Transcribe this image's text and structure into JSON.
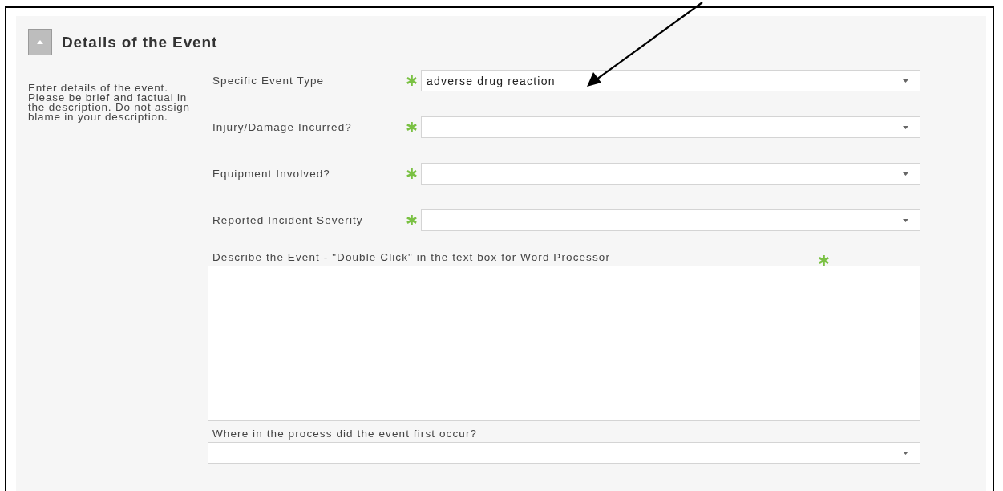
{
  "section": {
    "title": "Details of the Event",
    "expanded": true
  },
  "instructions": "Enter details of the event. Please be brief and factual in the description. Do not assign blame in your description.",
  "fields": [
    {
      "kind": "select",
      "label": "Specific Event Type",
      "required": true,
      "value": "adverse drug reaction"
    },
    {
      "kind": "select",
      "label": "Injury/Damage Incurred?",
      "required": true
    },
    {
      "kind": "select",
      "label": "Equipment Involved?",
      "required": true
    },
    {
      "kind": "select",
      "label": "Reported Incident Severity",
      "required": true
    },
    {
      "kind": "textarea",
      "label": "Describe the Event - \"Double Click\" in the text box for Word Processor",
      "required": true
    },
    {
      "kind": "stacked_select",
      "label": "Where in the process did the event first occur?",
      "required": false
    }
  ]
}
